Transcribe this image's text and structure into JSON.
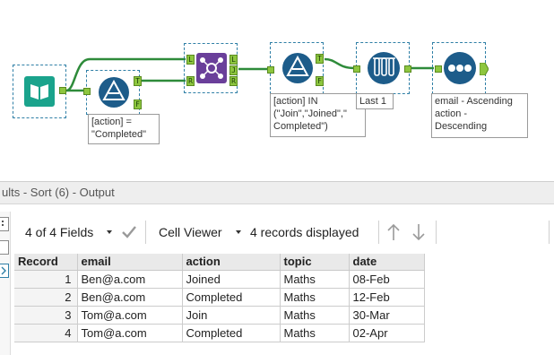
{
  "workflow": {
    "filter_1_annotation": "[action] =\n\"Completed\"",
    "filter_2_annotation": "[action] IN\n(\"Join\",\"Joined\",\"\nCompleted\")",
    "sample_annotation": "Last 1",
    "sort_annotation": "email - Ascending\naction -\nDescending",
    "filter_port_true": "T",
    "filter_port_false": "F",
    "join_port_left": "L",
    "join_port_right": "R",
    "join_port_join": "J",
    "connection_color": "#2e8b3a",
    "tool_blue": "#1d5c8a",
    "join_purple": "#6a3f9a",
    "input_teal": "#1aa38c"
  },
  "results": {
    "title": "ults - Sort (6) - Output",
    "fields_label": "4 of 4 Fields",
    "cell_viewer_label": "Cell Viewer",
    "records_label": "4 records displayed"
  },
  "table": {
    "columns": [
      "Record",
      "email",
      "action",
      "topic",
      "date"
    ],
    "rows": [
      {
        "record": "1",
        "email": "Ben@a.com",
        "action": "Joined",
        "topic": "Maths",
        "date": "08-Feb"
      },
      {
        "record": "2",
        "email": "Ben@a.com",
        "action": "Completed",
        "topic": "Maths",
        "date": "12-Feb"
      },
      {
        "record": "3",
        "email": "Tom@a.com",
        "action": "Join",
        "topic": "Maths",
        "date": "30-Mar"
      },
      {
        "record": "4",
        "email": "Tom@a.com",
        "action": "Completed",
        "topic": "Maths",
        "date": "02-Apr"
      }
    ]
  }
}
